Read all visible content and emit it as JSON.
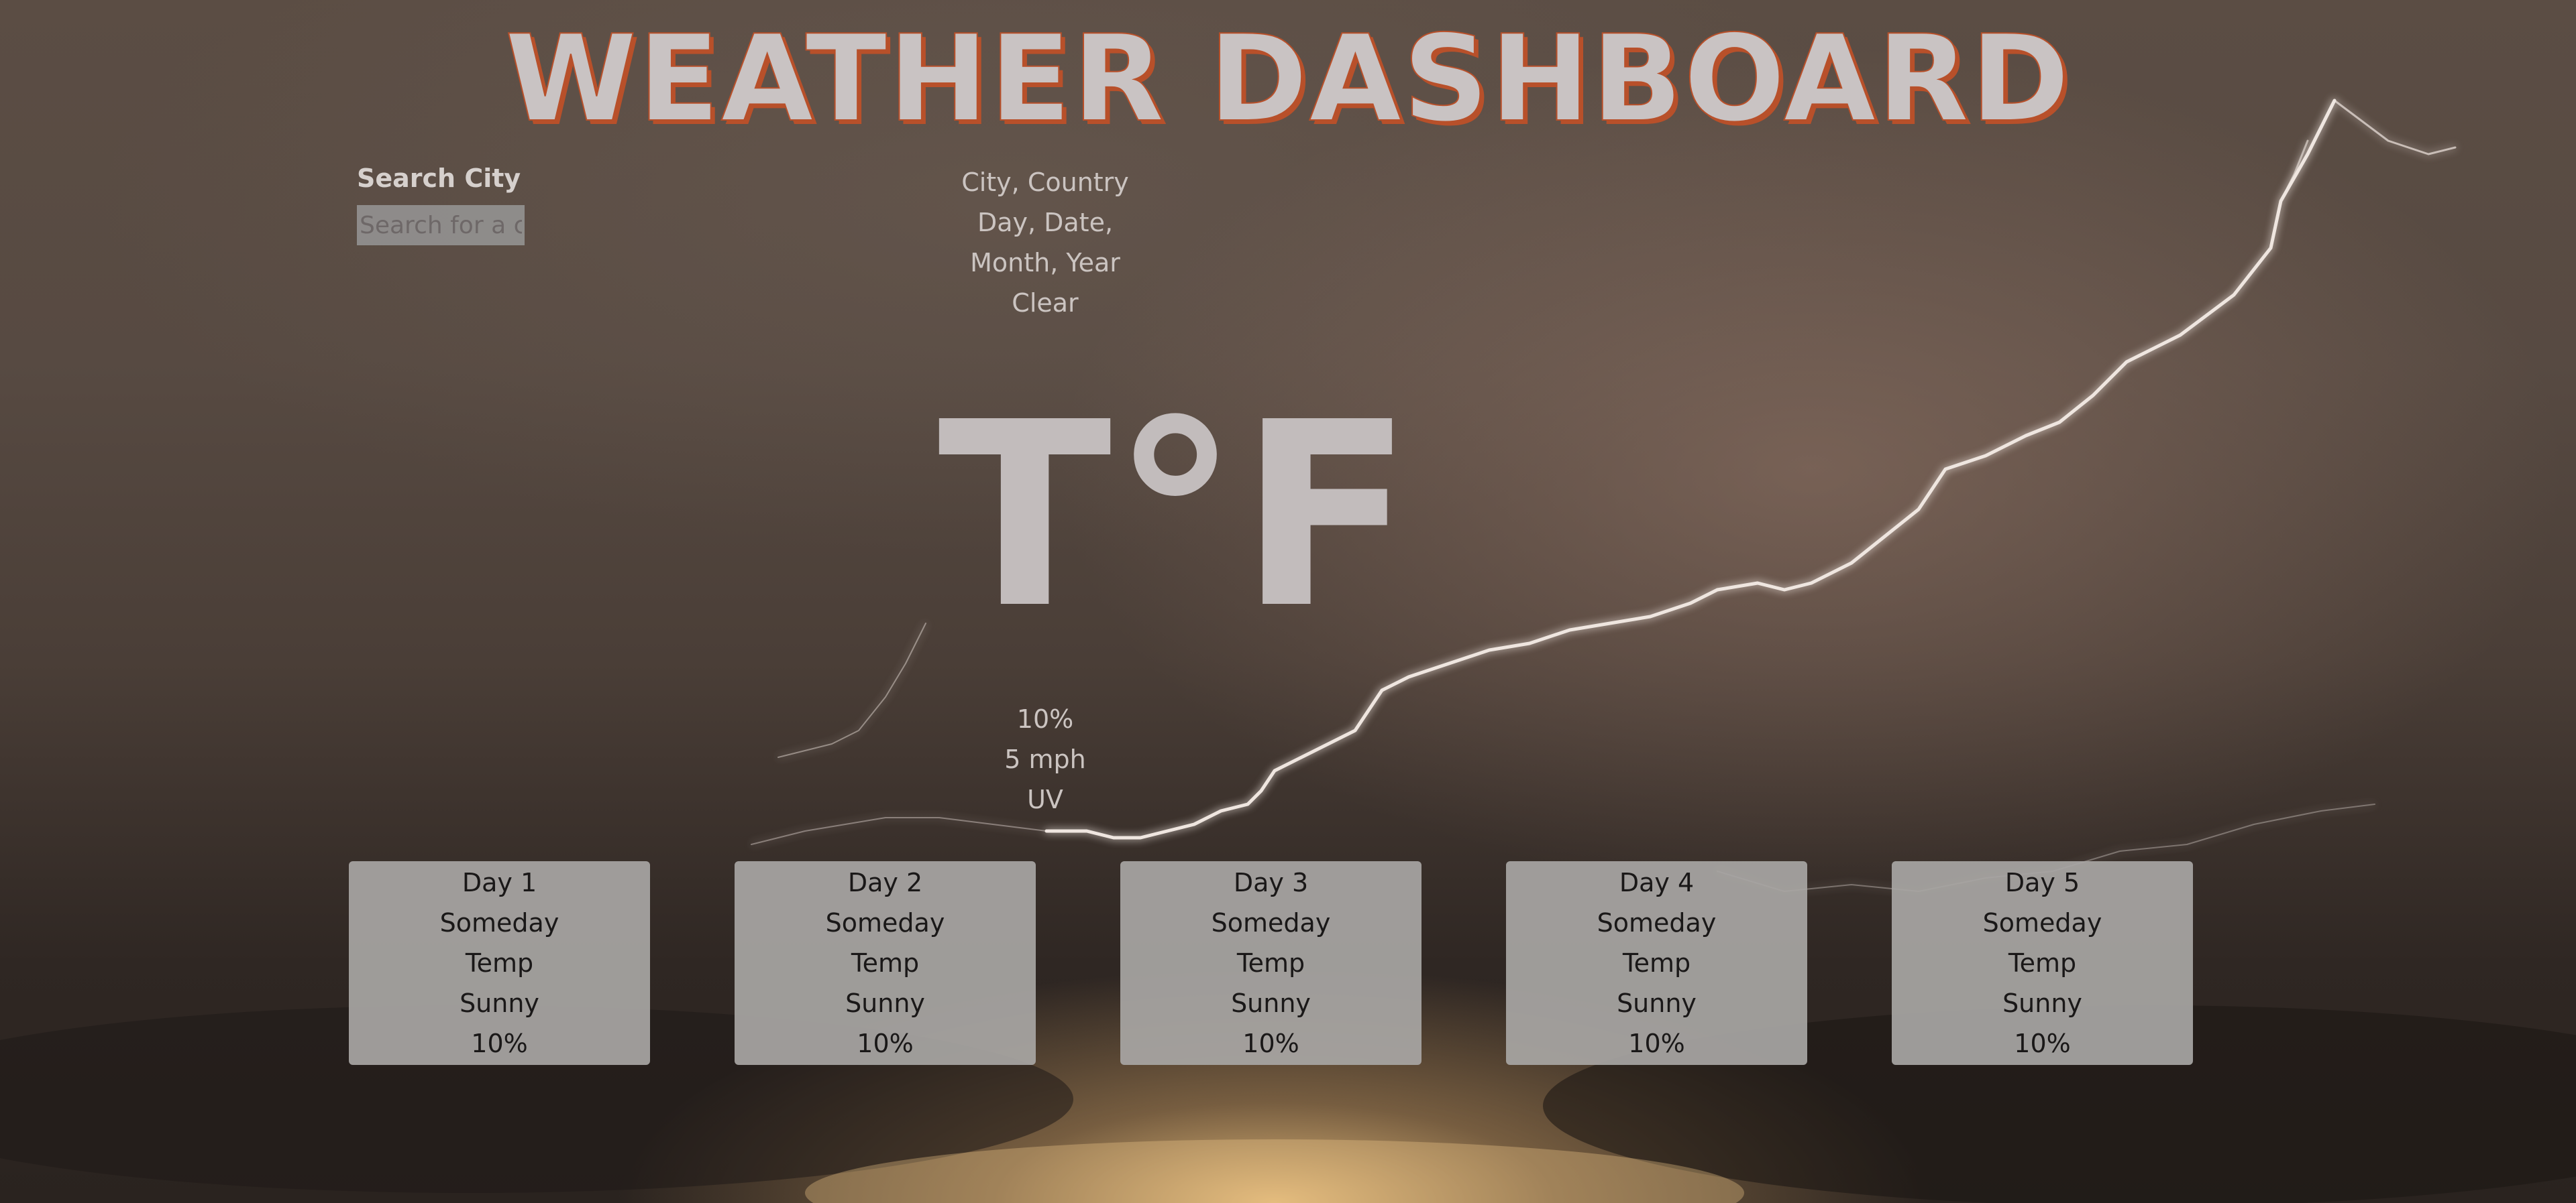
{
  "header": {
    "title": "WEATHER DASHBOARD"
  },
  "search": {
    "label": "Search City",
    "placeholder": "Search for a c",
    "value": ""
  },
  "current": {
    "location": "City, Country",
    "day_date": "Day, Date,",
    "month_year": "Month, Year",
    "condition": "Clear",
    "temperature": "T°F",
    "humidity": "10%",
    "wind": "5 mph",
    "uv": "UV"
  },
  "forecast": [
    {
      "day": "Day 1",
      "date": "Someday",
      "temp": "Temp",
      "condition": "Sunny",
      "humidity": "10%"
    },
    {
      "day": "Day 2",
      "date": "Someday",
      "temp": "Temp",
      "condition": "Sunny",
      "humidity": "10%"
    },
    {
      "day": "Day 3",
      "date": "Someday",
      "temp": "Temp",
      "condition": "Sunny",
      "humidity": "10%"
    },
    {
      "day": "Day 4",
      "date": "Someday",
      "temp": "Temp",
      "condition": "Sunny",
      "humidity": "10%"
    },
    {
      "day": "Day 5",
      "date": "Someday",
      "temp": "Temp",
      "condition": "Sunny",
      "humidity": "10%"
    }
  ],
  "colors": {
    "title_fill": "#c9c3c3",
    "title_outline": "#b8502a",
    "card_background": "#a8a6a4"
  }
}
